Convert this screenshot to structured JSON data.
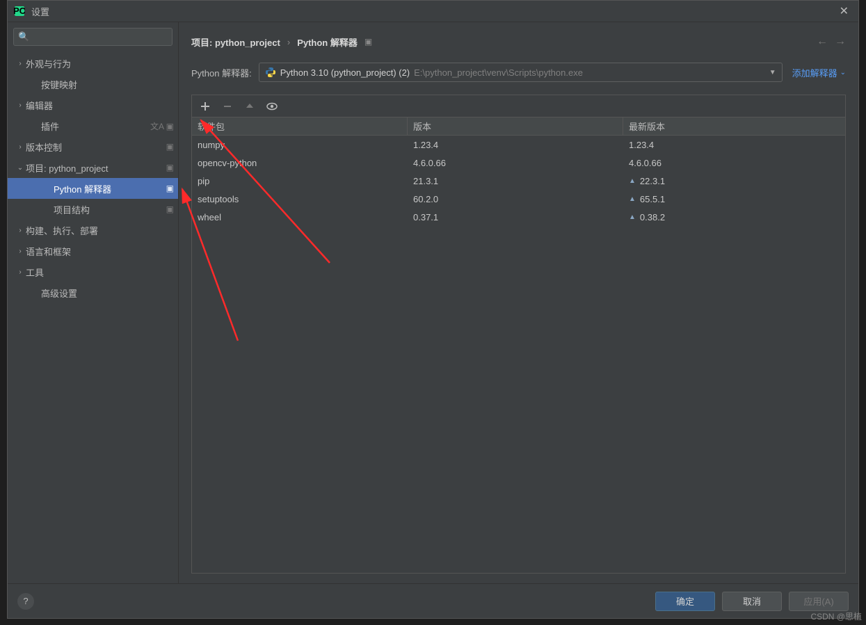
{
  "titlebar": {
    "title": "设置"
  },
  "search": {
    "placeholder": ""
  },
  "sidebar": {
    "items": [
      {
        "label": "外观与行为",
        "arrow": "›",
        "indent": 0
      },
      {
        "label": "按键映射",
        "arrow": "",
        "indent": 1
      },
      {
        "label": "编辑器",
        "arrow": "›",
        "indent": 0
      },
      {
        "label": "插件",
        "arrow": "",
        "indent": 1,
        "trailing": "文A ▣"
      },
      {
        "label": "版本控制",
        "arrow": "›",
        "indent": 0,
        "trailing": "▣"
      },
      {
        "label": "项目: python_project",
        "arrow": "⌄",
        "indent": 0,
        "trailing": "▣"
      },
      {
        "label": "Python 解释器",
        "arrow": "",
        "indent": 2,
        "trailing": "▣",
        "selected": true
      },
      {
        "label": "项目结构",
        "arrow": "",
        "indent": 2,
        "trailing": "▣"
      },
      {
        "label": "构建、执行、部署",
        "arrow": "›",
        "indent": 0
      },
      {
        "label": "语言和框架",
        "arrow": "›",
        "indent": 0
      },
      {
        "label": "工具",
        "arrow": "›",
        "indent": 0
      },
      {
        "label": "高级设置",
        "arrow": "",
        "indent": 1
      }
    ]
  },
  "breadcrumb": {
    "project": "项目: python_project",
    "page": "Python 解释器"
  },
  "interpreter": {
    "label": "Python 解释器:",
    "name": "Python 3.10 (python_project) (2)",
    "path": "E:\\python_project\\venv\\Scripts\\python.exe",
    "add": "添加解释器"
  },
  "packages": {
    "headers": {
      "name": "软件包",
      "version": "版本",
      "latest": "最新版本"
    },
    "rows": [
      {
        "name": "numpy",
        "version": "1.23.4",
        "latest": "1.23.4",
        "upgrade": false
      },
      {
        "name": "opencv-python",
        "version": "4.6.0.66",
        "latest": "4.6.0.66",
        "upgrade": false
      },
      {
        "name": "pip",
        "version": "21.3.1",
        "latest": "22.3.1",
        "upgrade": true
      },
      {
        "name": "setuptools",
        "version": "60.2.0",
        "latest": "65.5.1",
        "upgrade": true
      },
      {
        "name": "wheel",
        "version": "0.37.1",
        "latest": "0.38.2",
        "upgrade": true
      }
    ]
  },
  "footer": {
    "ok": "确定",
    "cancel": "取消",
    "apply": "应用(A)"
  },
  "watermark": "CSDN @思植"
}
